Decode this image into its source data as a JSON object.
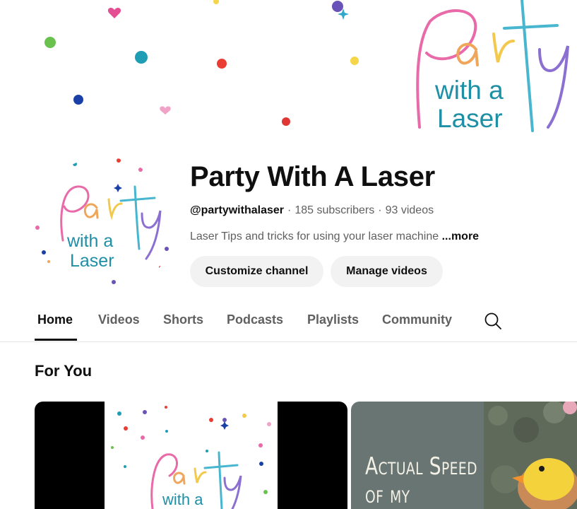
{
  "banner": {
    "logo_script": "Party",
    "logo_line2": "with a",
    "logo_line3": "Laser"
  },
  "avatar": {
    "logo_script": "Party",
    "logo_line2": "with a",
    "logo_line3": "Laser"
  },
  "channel": {
    "name": "Party With A Laser",
    "handle": "@partywithalaser",
    "separator": "·",
    "subscribers": "185 subscribers",
    "videos": "93 videos",
    "description": "Laser Tips and tricks for using your laser machine",
    "more_label": "...more"
  },
  "actions": {
    "customize_label": "Customize channel",
    "manage_label": "Manage videos"
  },
  "tabs": [
    {
      "label": "Home",
      "active": true
    },
    {
      "label": "Videos",
      "active": false
    },
    {
      "label": "Shorts",
      "active": false
    },
    {
      "label": "Podcasts",
      "active": false
    },
    {
      "label": "Playlists",
      "active": false
    },
    {
      "label": "Community",
      "active": false
    }
  ],
  "search_icon": "search-icon",
  "section": {
    "title": "For You"
  },
  "videos": [
    {
      "thumb_script": "Party",
      "thumb_line2": "with a"
    },
    {
      "overlay_text_line1": "Actual Speed",
      "overlay_text_line2": "of my"
    }
  ],
  "colors": {
    "logo_pink": "#e86aa8",
    "logo_teal": "#1e8fa5",
    "logo_purple": "#7b64c4",
    "logo_yellow": "#f2c94c",
    "text_primary": "#0f0f0f",
    "text_secondary": "#606060",
    "button_bg": "#f2f2f2"
  }
}
